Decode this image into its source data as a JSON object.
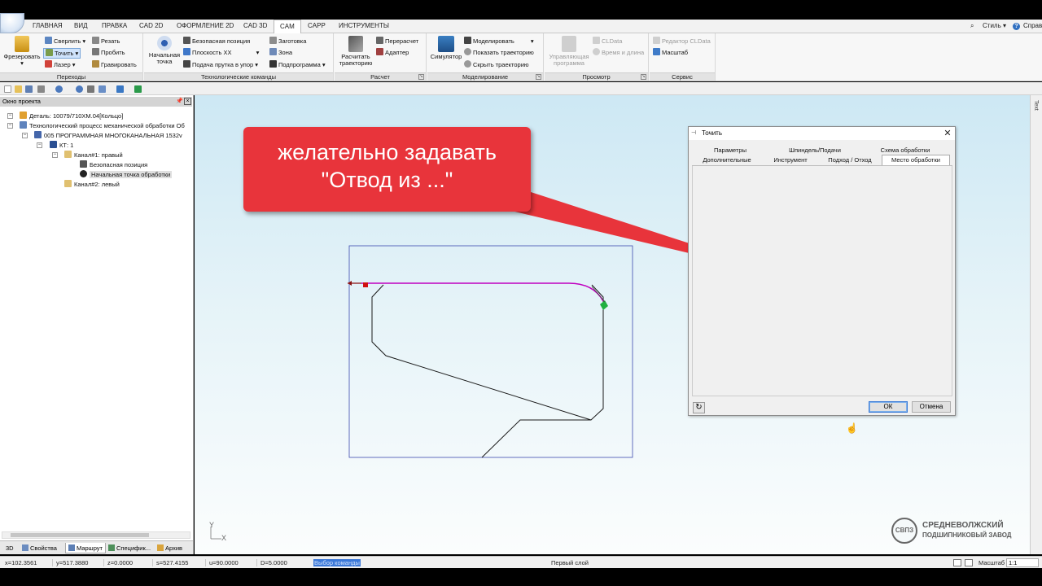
{
  "menu": {
    "items": [
      "ГЛАВНАЯ",
      "ВИД",
      "ПРАВКА",
      "CAD 2D",
      "ОФОРМЛЕНИЕ 2D",
      "CAD 3D",
      "CAM",
      "CAPP",
      "ИНСТРУМЕНТЫ"
    ],
    "style_label": "Стиль",
    "help_label": "Справка"
  },
  "ribbon": {
    "perehody": {
      "footer": "Переходы",
      "frezerovat": "Фрезеровать",
      "sverlit": "Сверлить",
      "tochit": "Точить",
      "lazer": "Лазер",
      "rezat": "Резать",
      "probit": "Пробить",
      "gravirovat": "Гравировать"
    },
    "tech": {
      "footer": "Технологические команды",
      "nach_tochka_1": "Начальная",
      "nach_tochka_2": "точка",
      "bezop_poz": "Безопасная позиция",
      "ploskost": "Плоскость ХХ",
      "podacha": "Подача прутка в упор",
      "zagotovka": "Заготовка",
      "zona": "Зона",
      "podprogramma": "Подпрограмма"
    },
    "raschet": {
      "footer": "Расчет",
      "rasschitat_1": "Расчитать",
      "rasschitat_2": "траекторию",
      "pereraschet": "Перерасчет",
      "adapter": "Адаптер"
    },
    "model": {
      "footer": "Моделирование",
      "simulyator": "Симулятор",
      "modelirovat": "Моделировать",
      "pokazat": "Показать траекторию",
      "skryt": "Скрыть траекторию"
    },
    "prosmotr": {
      "footer": "Просмотр",
      "upr_1": "Управляющая",
      "upr_2": "программа",
      "cldata": "CLData",
      "vremya": "Время и длина"
    },
    "servis": {
      "footer": "Сервис",
      "redaktor": "Редактор CLData",
      "masshtab": "Масштаб"
    }
  },
  "project_panel": {
    "title": "Окно проекта",
    "tree": {
      "detal": "Деталь: 10079/710ХМ.04[Кольцо]",
      "tech_process": "Технологический процесс механической обработки  Об",
      "operation": "005  ПРОГРАММНАЯ МНОГОКАНАЛЬНАЯ 1532v",
      "kt": "КТ: 1",
      "kanal1": "Канал#1: правый",
      "bezop": "Безопасная позиция",
      "nach": "Начальная точка обработки",
      "kanal2": "Канал#2: левый"
    },
    "tabs": [
      "3D",
      "Свойства",
      "Маршрут",
      "Специфик...",
      "Архив"
    ]
  },
  "callout": {
    "line1": "желательно задавать",
    "line2": "\"Отвод из ...\""
  },
  "dialog": {
    "title": "Точить",
    "tabs_row1": [
      "Параметры",
      "Шпиндель/Подачи",
      "Схема обработки"
    ],
    "tabs_row2": [
      "Дополнительные",
      "Инструмент",
      "Подход / Отход",
      "Место обработки"
    ],
    "active_tab": "Место обработки",
    "ok": "ОК",
    "cancel": "Отмена"
  },
  "viewport": {
    "axis_y": "Y",
    "axis_x": "X",
    "side_tab": "Text",
    "brand_logo": "СВПЗ",
    "brand_line1": "СРЕДНЕВОЛЖСКИЙ",
    "brand_line2": "ПОДШИПНИКОВЫЙ ЗАВОД",
    "trajectory_color": "#c000c0",
    "profile_color": "#1a1a1a",
    "frame_color": "#3c4ab0"
  },
  "status": {
    "x": "x=102.3561",
    "y": "y=517.3880",
    "z": "z=0.0000",
    "s": "s=527.4155",
    "u": "u=90.0000",
    "d": "D=5.0000",
    "command": "Выбор команды",
    "layer": "Первый слой",
    "scale_label": "Масштаб",
    "scale_value": "1:1"
  }
}
